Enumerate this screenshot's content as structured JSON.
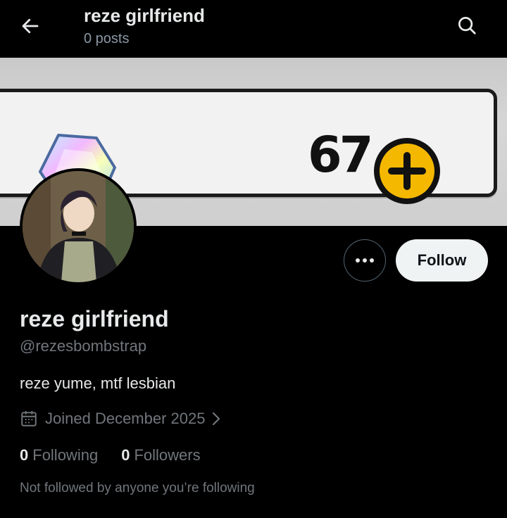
{
  "header": {
    "title": "reze girlfriend",
    "post_count": "0 posts",
    "back_icon": "arrow-left-icon",
    "search_icon": "search-icon"
  },
  "banner": {
    "number": "67",
    "gem_icon": "crystal-gem-icon",
    "plus_icon": "plus-coin-icon"
  },
  "profile": {
    "display_name": "reze girlfriend",
    "handle": "@rezesbombstrap",
    "bio": "reze yume, mtf lesbian",
    "joined": "Joined December 2025",
    "following_count": "0",
    "following_label": "Following",
    "followers_count": "0",
    "followers_label": "Followers",
    "followed_by_note": "Not followed by anyone you’re following"
  },
  "actions": {
    "follow_label": "Follow",
    "more_icon": "more-dots-icon"
  },
  "colors": {
    "background": "#000000",
    "primary_text": "#e7e9ea",
    "secondary_text": "#71767b",
    "follow_button_bg": "#eff3f4",
    "coin_yellow": "#f5b800"
  }
}
